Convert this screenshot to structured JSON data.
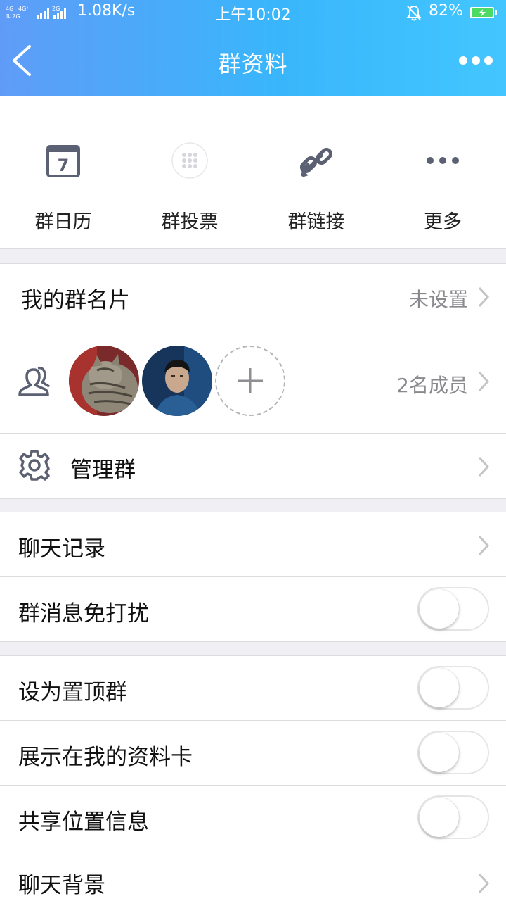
{
  "status_bar": {
    "network": "4G 4G 2G",
    "speed": "1.08K/s",
    "time": "上午10:02",
    "battery": "82%"
  },
  "nav": {
    "title": "群资料",
    "back_icon": "chevron-left-icon",
    "more_icon": "more-dots-icon"
  },
  "actions": [
    {
      "label": "群日历",
      "icon": "calendar-icon",
      "calendar_day": "7"
    },
    {
      "label": "群投票",
      "icon": "vote-grid-icon"
    },
    {
      "label": "群链接",
      "icon": "link-icon"
    },
    {
      "label": "更多",
      "icon": "more-dots-icon"
    }
  ],
  "group_card": {
    "label": "我的群名片",
    "value": "未设置"
  },
  "members": {
    "count_label": "2名成员",
    "icon": "members-icon"
  },
  "manage": {
    "label": "管理群",
    "icon": "gear-icon"
  },
  "chat_history": {
    "label": "聊天记录"
  },
  "mute": {
    "label": "群消息免打扰",
    "on": false
  },
  "pin_top": {
    "label": "设为置顶群",
    "on": false
  },
  "show_on_card": {
    "label": "展示在我的资料卡",
    "on": false
  },
  "share_location": {
    "label": "共享位置信息",
    "on": false
  },
  "chat_background": {
    "label": "聊天背景"
  },
  "colors": {
    "header_start": "#5f9cf8",
    "header_end": "#43c6ff",
    "icon_gray": "#5b6173",
    "secondary_text": "#8a8a8e"
  }
}
